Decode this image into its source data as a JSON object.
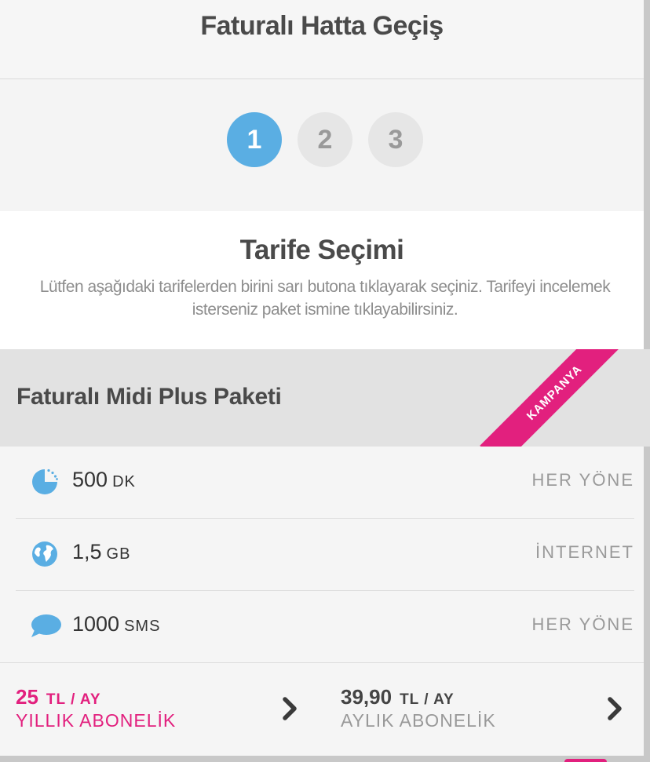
{
  "header": {
    "title": "Faturalı Hatta Geçiş"
  },
  "steps": [
    "1",
    "2",
    "3"
  ],
  "intro": {
    "title": "Tarife Seçimi",
    "description": "Lütfen aşağıdaki tarifelerden birini sarı butona tıklayarak seçiniz. Tarifeyi incelemek isterseniz paket ismine tıklayabilirsiniz."
  },
  "package": {
    "name": "Faturalı Midi Plus Paketi",
    "badge": "KAMPANYA",
    "features": [
      {
        "icon": "clock-icon",
        "amount": "500",
        "unit": "DK",
        "scope": "HER YÖNE"
      },
      {
        "icon": "globe-icon",
        "amount": "1,5",
        "unit": "GB",
        "scope": "İNTERNET"
      },
      {
        "icon": "chat-bubble-icon",
        "amount": "1000",
        "unit": "SMS",
        "scope": "HER YÖNE"
      }
    ],
    "prices": [
      {
        "amount": "25",
        "period": "TL / AY",
        "label": "YILLIK ABONELİK"
      },
      {
        "amount": "39,90",
        "period": "TL / AY",
        "label": "AYLIK ABONELİK"
      }
    ]
  },
  "colors": {
    "accent": "#e2207e",
    "active_step": "#5aaee3",
    "icon_blue": "#5aaee3"
  }
}
